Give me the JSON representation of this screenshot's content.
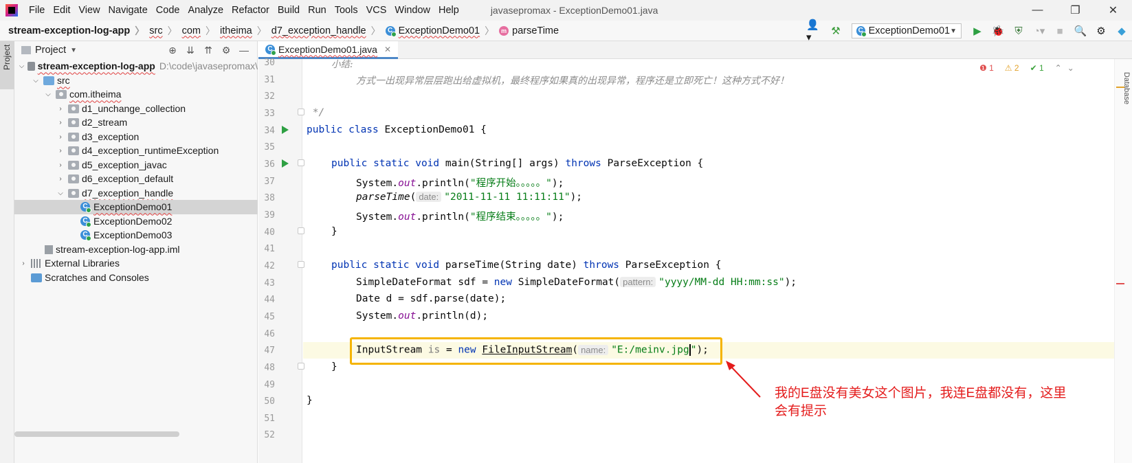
{
  "menu": {
    "items": [
      "File",
      "Edit",
      "View",
      "Navigate",
      "Code",
      "Analyze",
      "Refactor",
      "Build",
      "Run",
      "Tools",
      "VCS",
      "Window",
      "Help"
    ],
    "window_title": "javasepromax - ExceptionDemo01.java"
  },
  "window_controls": {
    "minimize": "—",
    "restore": "❐",
    "close": "✕"
  },
  "breadcrumb": {
    "project": "stream-exception-log-app",
    "src": "src",
    "com": "com",
    "itheima": "itheima",
    "package": "d7_exception_handle",
    "class": "ExceptionDemo01",
    "method": "parseTime"
  },
  "toolbar": {
    "run_config": "ExceptionDemo01"
  },
  "left_stripe": {
    "project_label": "Project"
  },
  "right_stripe": {
    "label": "Database"
  },
  "project_panel": {
    "title": "Project",
    "root": {
      "name": "stream-exception-log-app",
      "path": "D:\\code\\javasepromax\\"
    },
    "src": "src",
    "package_root": "com.itheima",
    "packages": [
      "d1_unchange_collection",
      "d2_stream",
      "d3_exception",
      "d4_exception_runtimeException",
      "d5_exception_javac",
      "d6_exception_default",
      "d7_exception_handle"
    ],
    "classes": [
      "ExceptionDemo01",
      "ExceptionDemo02",
      "ExceptionDemo03"
    ],
    "iml": "stream-exception-log-app.iml",
    "external_libraries": "External Libraries",
    "scratches": "Scratches and Consoles"
  },
  "editor": {
    "tab": "ExceptionDemo01.java",
    "status": {
      "errors": "1",
      "warnings": "2",
      "ok": "1"
    },
    "line_numbers": [
      "30",
      "31",
      "32",
      "33",
      "34",
      "35",
      "36",
      "37",
      "38",
      "39",
      "40",
      "41",
      "42",
      "43",
      "44",
      "45",
      "46",
      "47",
      "48",
      "49",
      "50",
      "51",
      "52"
    ],
    "code": {
      "l30": "小结:",
      "l31": "方式一出现异常层层跑出给虚拟机，最终程序如果真的出现异常，程序还是立即死亡！这种方式不好！",
      "l33": " */",
      "l34_kw": "public class",
      "l34_rest": " ExceptionDemo01 {",
      "l36_kw": "public static void",
      "l36_a": " main(String[] args) ",
      "l36_kw2": "throws",
      "l36_b": " ParseException {",
      "l37_a": "System.",
      "l37_field": "out",
      "l37_b": ".println(",
      "l37_str": "\"程序开始。。。。。\"",
      "l37_c": ");",
      "l38_method": "parseTime",
      "l38_a": "(",
      "l38_hint": "date:",
      "l38_str": "\"2011-11-11 11:11:11\"",
      "l38_c": ");",
      "l39_a": "System.",
      "l39_field": "out",
      "l39_b": ".println(",
      "l39_str": "\"程序结束。。。。。\"",
      "l39_c": ");",
      "l40": "}",
      "l42_kw": "public static void",
      "l42_a": " parseTime(String date) ",
      "l42_kw2": "throws",
      "l42_b": " ParseException {",
      "l43_a": "SimpleDateFormat sdf = ",
      "l43_kw": "new",
      "l43_b": " SimpleDateFormat(",
      "l43_hint": "pattern:",
      "l43_str": "\"yyyy/MM-dd HH:mm:ss\"",
      "l43_c": ");",
      "l44": "Date d = sdf.parse(date);",
      "l45_a": "System.",
      "l45_field": "out",
      "l45_b": ".println(d);",
      "l47_a": "InputStream ",
      "l47_var": "is",
      "l47_b": " = ",
      "l47_kw": "new",
      "l47_cls": "FileInputStream",
      "l47_c": "(",
      "l47_hint": "name:",
      "l47_str1": "\"E:/meinv.jpg",
      "l47_str2": "\"",
      "l47_d": ");",
      "l48": "}",
      "l50": "}"
    }
  },
  "annotation": {
    "text": "我的E盘没有美女这个图片，我连E盘都没有，这里会有提示",
    "highlight_color": "#f5b400",
    "text_color": "#e41c1c"
  }
}
